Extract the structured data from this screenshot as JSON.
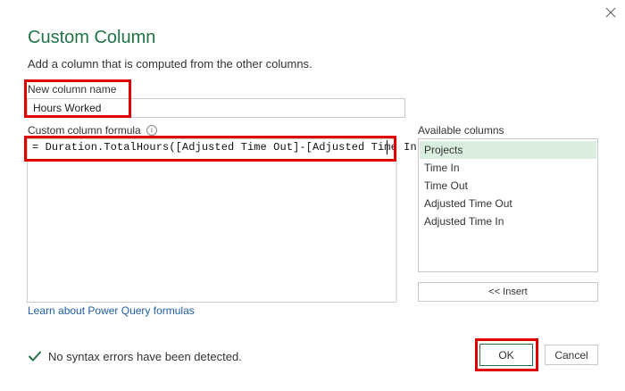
{
  "dialog": {
    "title": "Custom Column",
    "subtitle": "Add a column that is computed from the other columns.",
    "close_icon": "close-icon"
  },
  "new_column": {
    "label": "New column name",
    "value": "Hours Worked"
  },
  "formula": {
    "label": "Custom column formula",
    "info_icon": "info-icon",
    "value": "= Duration.TotalHours([Adjusted Time Out]-[Adjusted Time In])"
  },
  "available_columns": {
    "label": "Available columns",
    "items": [
      {
        "label": "Projects",
        "selected": true
      },
      {
        "label": "Time In",
        "selected": false
      },
      {
        "label": "Time Out",
        "selected": false
      },
      {
        "label": "Adjusted Time Out",
        "selected": false
      },
      {
        "label": "Adjusted Time In",
        "selected": false
      }
    ],
    "insert_label": "<< Insert"
  },
  "learn_link": "Learn about Power Query formulas",
  "status": {
    "icon": "check-icon",
    "text": "No syntax errors have been detected.",
    "color": "#217346"
  },
  "buttons": {
    "ok": "OK",
    "cancel": "Cancel"
  },
  "colors": {
    "accent": "#217346",
    "selection": "#daeee0",
    "highlight": "#e00000",
    "link": "#1f5fa8"
  }
}
